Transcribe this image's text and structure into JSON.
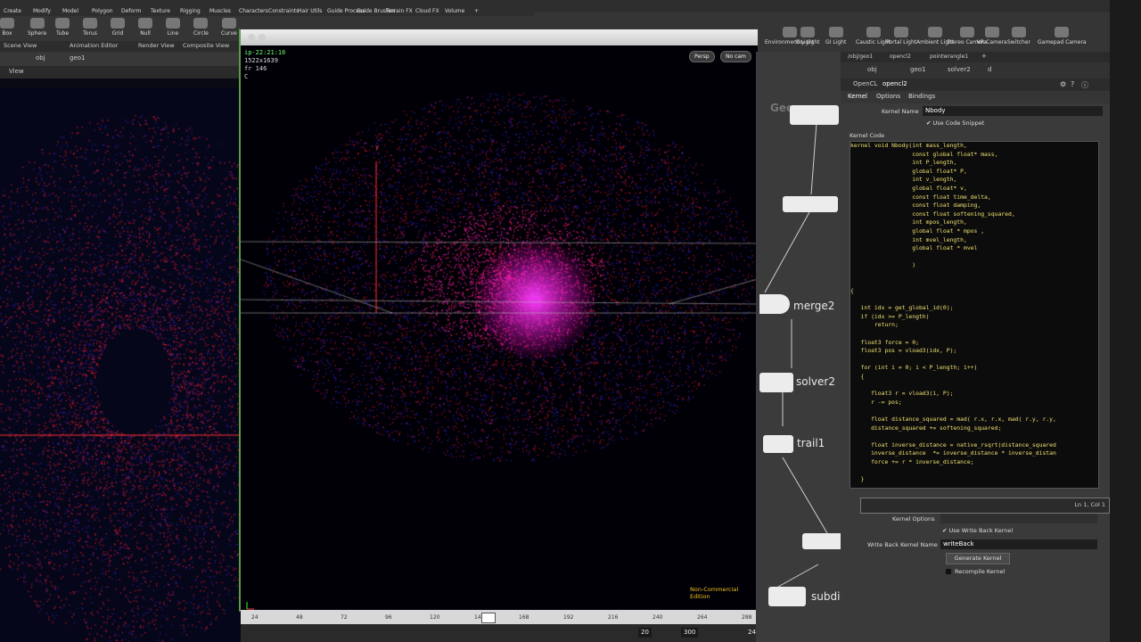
{
  "shelf": {
    "tabs_left": [
      "Create",
      "Modify",
      "Model",
      "Polygon",
      "Deform",
      "Texture",
      "Rigging",
      "Muscles",
      "Characters",
      "Constraints",
      "Hair Utils",
      "Guide Process",
      "Guide Brushes",
      "Terrain FX",
      "Cloud FX",
      "Volume",
      "+"
    ],
    "tools_left": [
      "Box",
      "Sphere",
      "Tube",
      "Torus",
      "Grid",
      "Null",
      "Line",
      "Circle",
      "Curve"
    ],
    "tabs_right": [
      "Lights and C...",
      "Collisions",
      "Particles",
      "Grains",
      "Rigid Bodies",
      "Particle Fluids",
      "Viscous Fluids",
      "Oceans",
      "Fluid Contai...",
      "Populate Con...",
      "Container Tools",
      "Pyro FX",
      "Cloth",
      "Solid",
      "Wires",
      "Crowds",
      "Drive Simula..."
    ],
    "tools_right": [
      "Environment Light",
      "Sky Light",
      "GI Light",
      "Caustic Light",
      "Portal Light",
      "Ambient Light",
      "Stereo Camera",
      "VR Camera",
      "Switcher",
      "Gamepad Camera"
    ]
  },
  "left_panel": {
    "tabs": [
      "Scene View",
      "Animation Editor",
      "Render View",
      "Composite View"
    ],
    "path": [
      "obj",
      "geo1"
    ],
    "view_label": "View"
  },
  "viewport": {
    "hud_lines": [
      "ip-22:21:16",
      "1522x1639",
      "fr 146",
      "C"
    ],
    "persp_label": "Persp",
    "cam_label": "No cam",
    "axis_label": "y",
    "watermark": "Non-Commercial Edition"
  },
  "timeline": {
    "ticks": [
      "24",
      "48",
      "72",
      "96",
      "120",
      "146",
      "168",
      "192",
      "216",
      "240",
      "264",
      "288"
    ],
    "current": "146",
    "start_frame": "20",
    "end_frame": "300",
    "fps": "24"
  },
  "network": {
    "nodes": [
      "Geo",
      "merge2",
      "solver2",
      "trail1",
      "subdivid"
    ]
  },
  "params": {
    "path_tabs": [
      "/obj/geo1",
      "opencl2",
      "pointwrangle1",
      "+"
    ],
    "path": [
      "obj",
      "geo1",
      "solver2",
      "d"
    ],
    "node_type": "OpenCL",
    "node_name": "opencl2",
    "tabs": [
      "Kernel",
      "Options",
      "Bindings"
    ],
    "kernel_name_label": "Kernel Name",
    "kernel_name": "Nbody",
    "use_snippet_label": "Use Code Snippet",
    "kernel_code_label": "Kernel Code",
    "code": "kernel void Nbody(int mass_length,\n                  const global float* mass,\n                  int P_length,\n                  global float* P,\n                  int v_length,\n                  global float* v,\n                  const float time_delta,\n                  const float damping,\n                  const float softening_squared,\n                  int mpos_length,\n                  global float * mpos ,\n                  int mvel_length,\n                  global float * mvel\n\n                  )\n\n\n{\n\n   int idx = get_global_id(0);\n   if (idx >= P_length)\n       return;\n\n   float3 force = 0;\n   float3 pos = vload3(idx, P);\n\n   for (int i = 0; i < P_length; i++)\n   {\n\n      float3 r = vload3(i, P);\n      r -= pos;\n\n      float distance_squared = mad( r.x, r.x, mad( r.y, r.y,\n      distance_squared += softening_squared;\n\n      float inverse_distance = native_rsqrt(distance_squared\n      inverse_distance  *= inverse_distance * inverse_distan\n      force += r * inverse_distance;\n\n   }",
    "cursor_pos": "Ln 1, Col 1",
    "kernel_options_label": "Kernel Options",
    "use_write_back_label": "Use Write Back Kernel",
    "write_back_name_label": "Write Back Kernel Name",
    "write_back_name": "writeBack",
    "generate_kernel": "Generate Kernel",
    "recompile_kernel": "Recompile Kernel"
  },
  "colors": {
    "particle_red": "#ff1a40",
    "particle_magenta": "#ff2ad0",
    "particle_blue": "#3a2aff",
    "code_text": "#f0e070",
    "keyword": "#ff7ad8"
  }
}
